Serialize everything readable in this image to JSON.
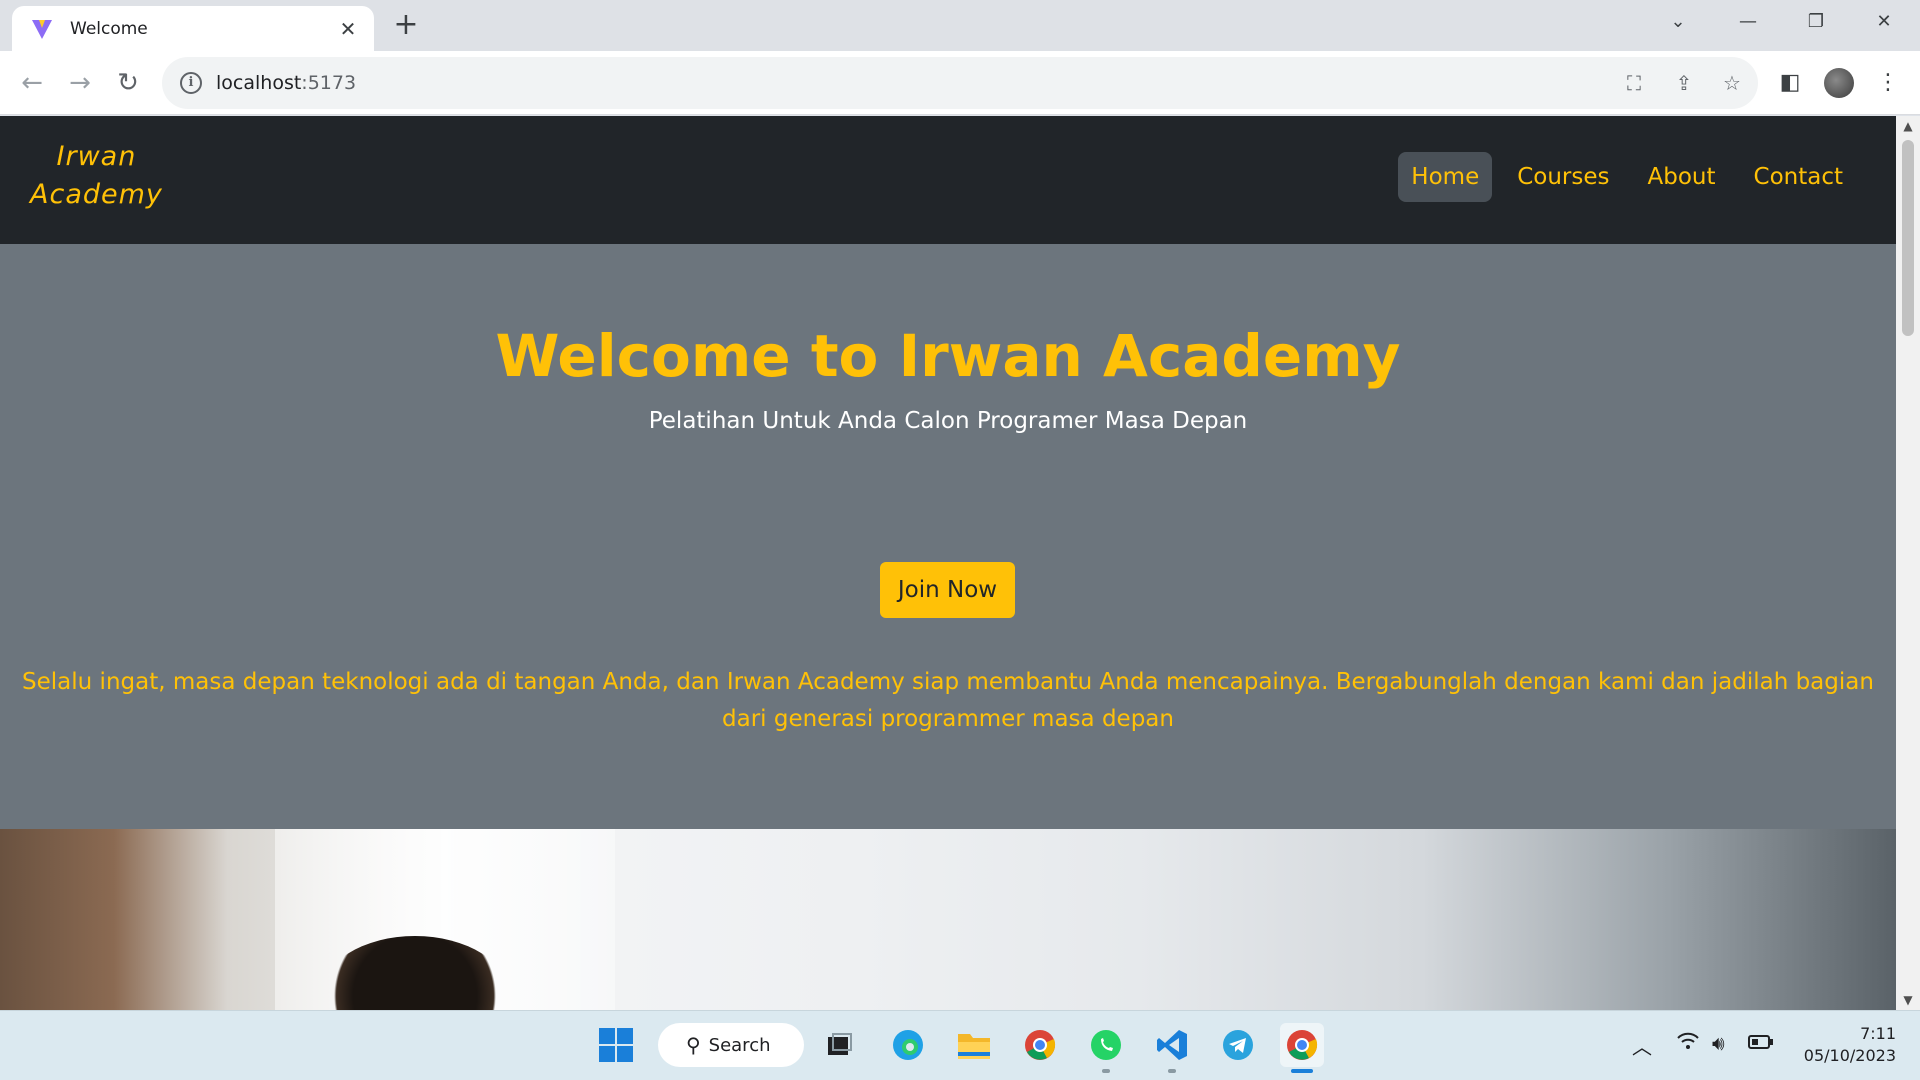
{
  "browser": {
    "tab_title": "Welcome",
    "url_host": "localhost",
    "url_port": ":5173"
  },
  "site": {
    "brand_line1": "Irwan",
    "brand_line2": "Academy",
    "nav": [
      {
        "label": "Home",
        "active": true
      },
      {
        "label": "Courses",
        "active": false
      },
      {
        "label": "About",
        "active": false
      },
      {
        "label": "Contact",
        "active": false
      }
    ],
    "hero": {
      "title": "Welcome to Irwan Academy",
      "subtitle": "Pelatihan Untuk Anda Calon Programer Masa Depan",
      "cta": "Join Now",
      "paragraph": "Selalu ingat, masa depan teknologi ada di tangan Anda, dan Irwan Academy siap membantu Anda mencapainya. Bergabunglah dengan kami dan jadilah bagian dari generasi programmer masa depan"
    }
  },
  "taskbar": {
    "search_label": "Search",
    "time": "7:11",
    "date": "05/10/2023"
  },
  "colors": {
    "accent": "#ffc107",
    "navbar": "#212529",
    "hero_bg": "#6c757d"
  }
}
